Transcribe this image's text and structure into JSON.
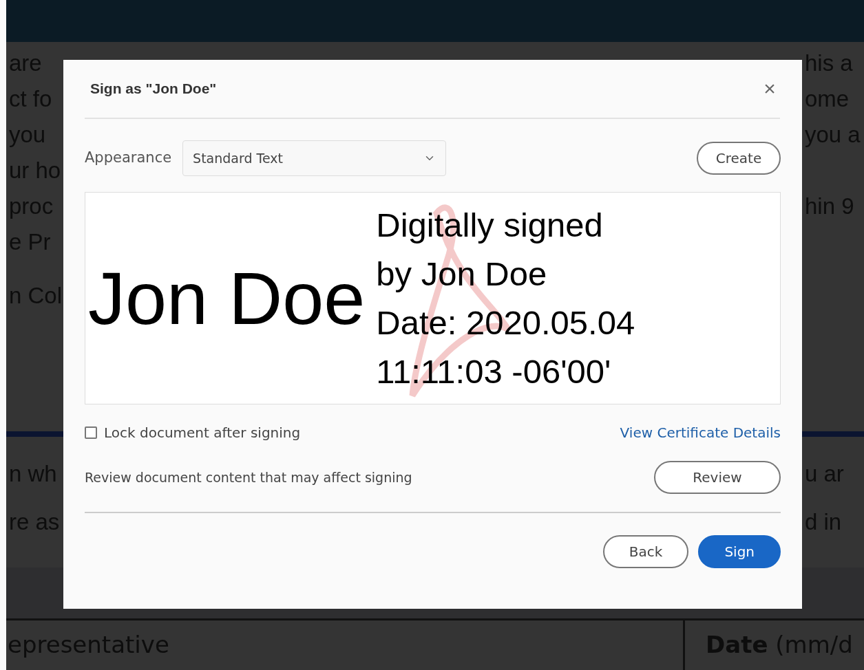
{
  "document": {
    "upper_paragraphs": [
      [
        {
          "left": "are",
          "right": "his a"
        },
        {
          "left": "ct fo",
          "right": "ome"
        },
        {
          "left": "you",
          "right": "you a"
        },
        {
          "left": "ur ho"
        },
        {
          "left": "proc",
          "right": "hin 9"
        },
        {
          "left": "e Pr"
        }
      ],
      [
        {
          "left": "n Col"
        }
      ]
    ],
    "lower_lines": [
      {
        "left": "n wh",
        "right": "u ar"
      },
      {
        "left": "re as",
        "right": "d in"
      }
    ],
    "table_cells": [
      "epresentative",
      "**Date** (mm/d"
    ]
  },
  "dialog": {
    "title": "Sign as \"Jon Doe\"",
    "close": "×",
    "appearance": {
      "label": "Appearance",
      "value": "Standard Text"
    },
    "create_button": "Create",
    "preview": {
      "name": "Jon Doe",
      "details": [
        "Digitally signed",
        "by Jon Doe",
        "Date: 2020.05.04",
        "11:11:03 -06'00'"
      ]
    },
    "lock": {
      "label": "Lock document after signing",
      "checked": false
    },
    "certificate_link": "View Certificate Details",
    "review": {
      "text": "Review document content that may affect signing",
      "button": "Review"
    },
    "buttons": [
      {
        "label": "Back",
        "kind": "secondary"
      },
      {
        "label": "Sign",
        "kind": "primary"
      }
    ]
  }
}
